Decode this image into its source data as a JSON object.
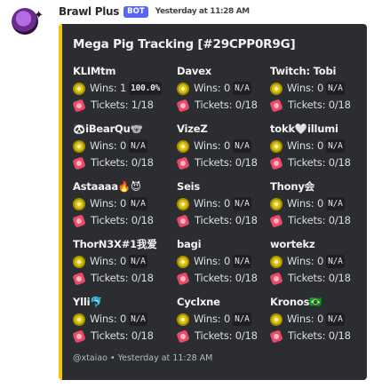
{
  "message": {
    "author": "Brawl Plus",
    "bot_tag": "BOT",
    "timestamp": "Yesterday at 11:28 AM",
    "avatar_icon": "pig-avatar-icon"
  },
  "embed": {
    "accent_color": "#f1c40f",
    "title": "Mega Pig Tracking [#29CPP0R9G]",
    "footer": "@xtaiao • Yesterday at 11:28 AM",
    "wins_label": "Wins:",
    "tickets_label": "Tickets:",
    "fields": [
      {
        "name": "KLIMtm",
        "wins": "1",
        "wins_pct": "100.0%",
        "tickets": "1/18"
      },
      {
        "name": "Davex",
        "wins": "0",
        "wins_pct": "N/A",
        "tickets": "0/18"
      },
      {
        "name": "Twitch: Tobi",
        "wins": "0",
        "wins_pct": "N/A",
        "tickets": "0/18"
      },
      {
        "name": "🐼iBearQu🐨",
        "wins": "0",
        "wins_pct": "N/A",
        "tickets": "0/18"
      },
      {
        "name": "VizeZ",
        "wins": "0",
        "wins_pct": "N/A",
        "tickets": "0/18"
      },
      {
        "name": "tokk🤍illumi",
        "wins": "0",
        "wins_pct": "N/A",
        "tickets": "0/18"
      },
      {
        "name": "Astaaaa🔥😈",
        "wins": "0",
        "wins_pct": "N/A",
        "tickets": "0/18"
      },
      {
        "name": "Seis",
        "wins": "0",
        "wins_pct": "N/A",
        "tickets": "0/18"
      },
      {
        "name": "Thony会",
        "wins": "0",
        "wins_pct": "N/A",
        "tickets": "0/18"
      },
      {
        "name": "ThorN3X#1我爱",
        "wins": "0",
        "wins_pct": "N/A",
        "tickets": "0/18"
      },
      {
        "name": "bagi",
        "wins": "0",
        "wins_pct": "N/A",
        "tickets": "0/18"
      },
      {
        "name": "wortekz",
        "wins": "0",
        "wins_pct": "N/A",
        "tickets": "0/18"
      },
      {
        "name": "Ylli🐬",
        "wins": "0",
        "wins_pct": "N/A",
        "tickets": "0/18"
      },
      {
        "name": "Cyclxne",
        "wins": "0",
        "wins_pct": "N/A",
        "tickets": "0/18"
      },
      {
        "name": "Kronos🇧🇷",
        "wins": "0",
        "wins_pct": "N/A",
        "tickets": "0/18"
      }
    ]
  }
}
